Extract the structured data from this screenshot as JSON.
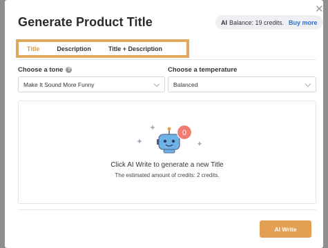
{
  "modal": {
    "title": "Generate Product Title",
    "close_icon": "close-icon"
  },
  "balance": {
    "ai_label": "AI",
    "text": "Balance: 19 credits.",
    "buy_label": "Buy more"
  },
  "tabs": [
    {
      "label": "Title",
      "active": true
    },
    {
      "label": "Description",
      "active": false
    },
    {
      "label": "Title + Description",
      "active": false
    }
  ],
  "tone": {
    "label": "Choose a tone",
    "selected": "Make It Sound More Funny"
  },
  "temperature": {
    "label": "Choose a temperature",
    "selected": "Balanced"
  },
  "empty_state": {
    "icon": "robot-icon",
    "badge": "0",
    "line1": "Click AI Write to generate a new Title",
    "line2": "The estimated amount of credits: 2 credits."
  },
  "actions": {
    "ai_write_label": "AI Write"
  },
  "colors": {
    "accent": "#e3a052",
    "tab_active": "#e49a3a",
    "link": "#2a6fd6",
    "highlight_border": "#e1a95f"
  }
}
